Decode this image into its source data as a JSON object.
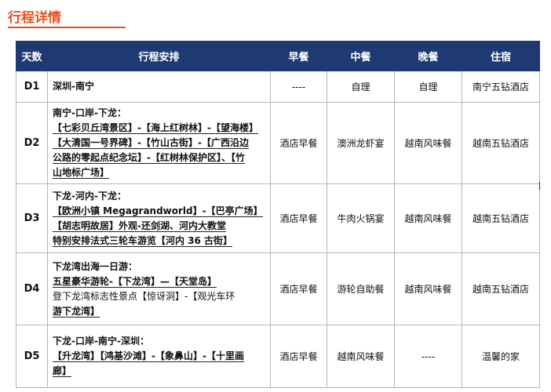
{
  "title": "行程详情",
  "headers": {
    "day": "天数",
    "plan": "行程安排",
    "breakfast": "早餐",
    "lunch": "中餐",
    "dinner": "晚餐",
    "hotel": "住宿"
  },
  "rows": [
    {
      "day": "D1",
      "lines": [
        "深圳-南宁"
      ],
      "breakfast": "----",
      "lunch": "自理",
      "dinner": "自理",
      "hotel": "南宁五钻酒店"
    },
    {
      "day": "D2",
      "lines": [
        "南宁-口岸-下龙：",
        "【七彩贝丘湾景区】-【海上红树林】-【望海楼】",
        "【大清国一号界碑】-【竹山古街】-【广西沿边",
        "公路的零起点纪念坛】-【红树林保护区】、【竹",
        "山地标广场】"
      ],
      "breakfast": "酒店早餐",
      "lunch": "澳洲龙虾宴",
      "dinner": "越南风味餐",
      "hotel": "越南五钻酒店"
    },
    {
      "day": "D3",
      "lines": [
        "下龙-河内-下龙：",
        "【欧洲小镇 Megagrandworld】-【巴亭广场】",
        "【胡志明故居】外观-还剑湖、河内大教堂",
        "特别安排法式三轮车游览【河内 36 古街】"
      ],
      "breakfast": "酒店早餐",
      "lunch": "牛肉火锅宴",
      "dinner": "越南风味餐",
      "hotel": "越南五钻酒店"
    },
    {
      "day": "D4",
      "lines": [
        "下龙湾出海一日游：",
        "五星豪华游轮-【下龙湾】—【天堂岛】",
        "登下龙湾标志性景点【惊讶洞】-【观光车环",
        "游下龙湾】"
      ],
      "breakfast": "酒店早餐",
      "lunch": "游轮自助餐",
      "dinner": "越南风味餐",
      "hotel": "越南五钻酒店"
    },
    {
      "day": "D5",
      "lines": [
        "下龙-口岸-南宁-深圳：",
        "【升龙湾】【鸿基沙滩】-【象鼻山】-【十里画",
        "廊】"
      ],
      "breakfast": "酒店早餐",
      "lunch": "越南风味餐",
      "dinner": "----",
      "hotel": "温馨的家"
    }
  ]
}
